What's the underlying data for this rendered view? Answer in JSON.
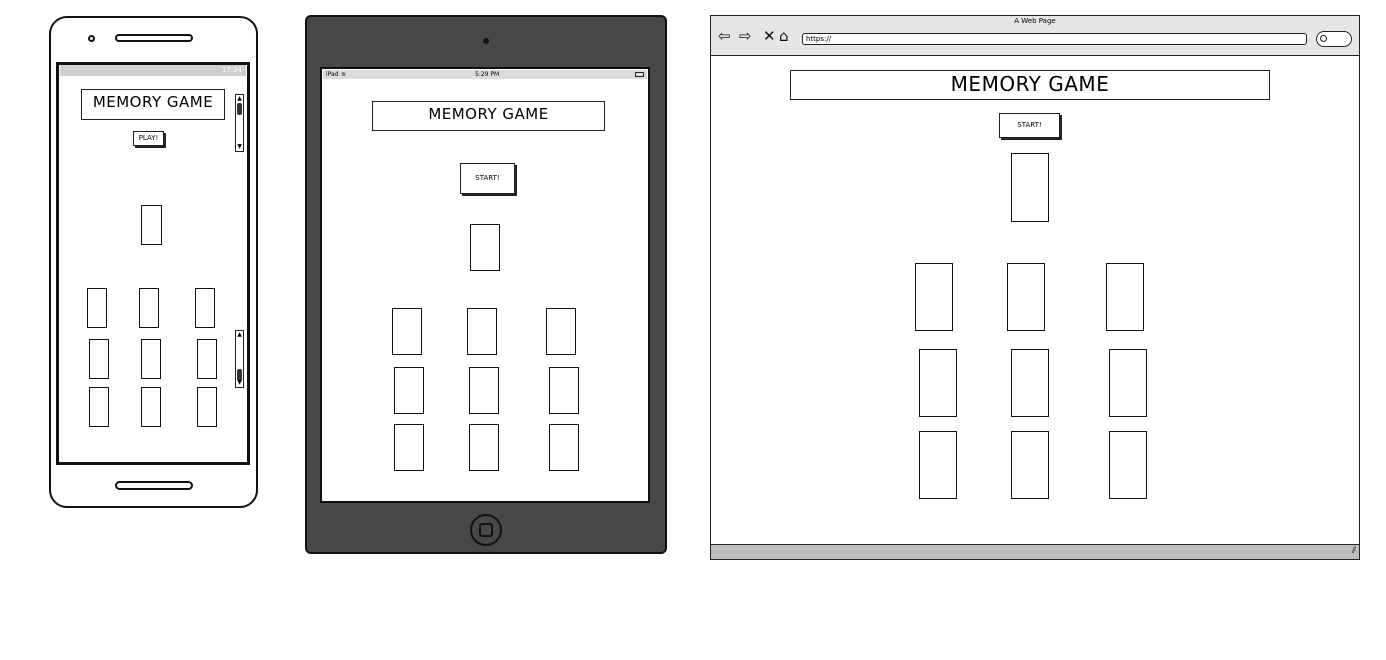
{
  "phone": {
    "title": "MEMORY GAME",
    "button_label": "PLAY!",
    "status_time": "17:24"
  },
  "tablet": {
    "title": "MEMORY GAME",
    "button_label": "START!",
    "status_left": "iPad",
    "status_time": "5:29 PM"
  },
  "browser": {
    "window_title": "A Web Page",
    "url": "https://",
    "title": "MEMORY GAME",
    "button_label": "START!"
  },
  "icons": {
    "back": "left-arrow",
    "forward": "right-arrow",
    "stop": "close",
    "home": "home",
    "search": "magnifier"
  }
}
